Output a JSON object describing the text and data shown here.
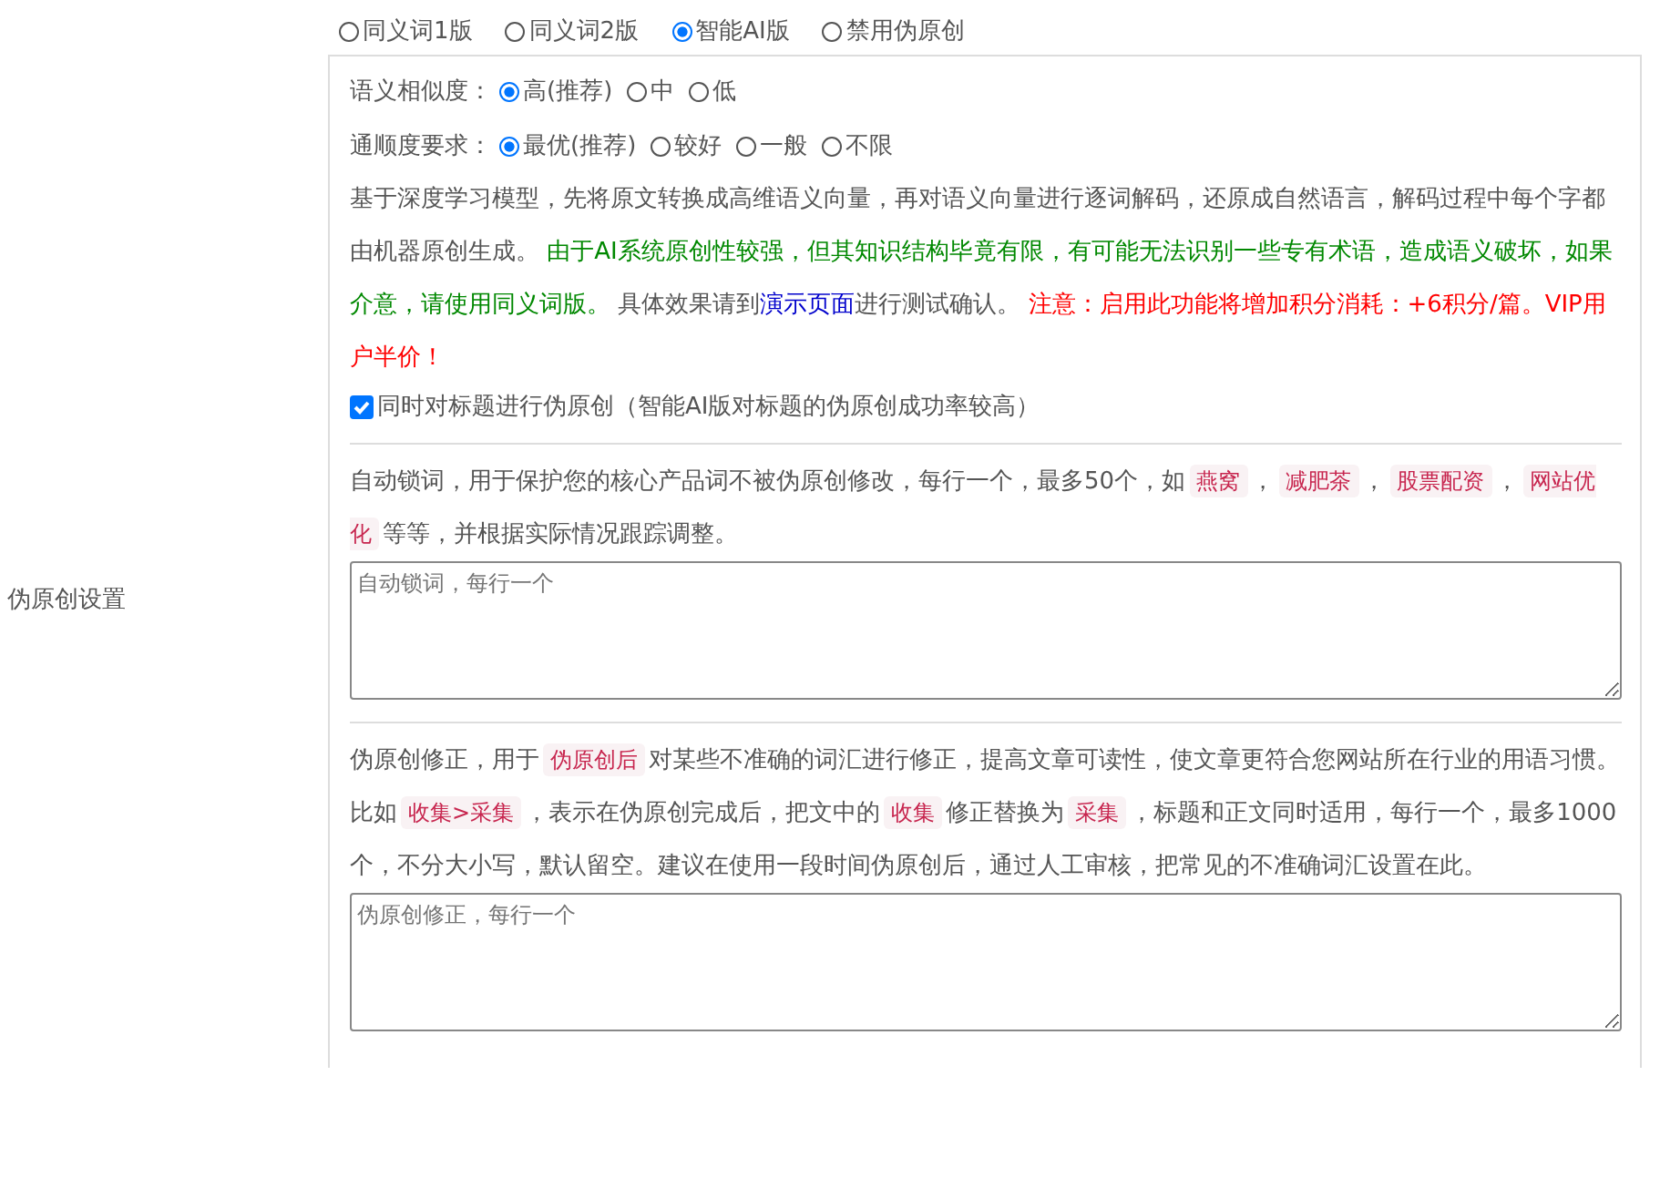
{
  "side_label": "伪原创设置",
  "modes": [
    {
      "label": "同义词1版",
      "selected": false
    },
    {
      "label": "同义词2版",
      "selected": false
    },
    {
      "label": "智能AI版",
      "selected": true
    },
    {
      "label": "禁用伪原创",
      "selected": false
    }
  ],
  "similarity": {
    "label": "语义相似度：",
    "options": [
      {
        "label": "高(推荐)",
        "selected": true
      },
      {
        "label": "中",
        "selected": false
      },
      {
        "label": "低",
        "selected": false
      }
    ]
  },
  "fluency": {
    "label": "通顺度要求：",
    "options": [
      {
        "label": "最优(推荐)",
        "selected": true
      },
      {
        "label": "较好",
        "selected": false
      },
      {
        "label": "一般",
        "selected": false
      },
      {
        "label": "不限",
        "selected": false
      }
    ]
  },
  "ai_description": [
    {
      "kind": "plain",
      "text": "基于深度学习模型，先将原文转换成高维语义向量，再对语义向量进行逐词解码，还原成自然语言，解码过程中每个字都由机器原创生成。 "
    },
    {
      "kind": "notice",
      "text": "由于AI系统原创性较强，但其知识结构毕竟有限，有可能无法识别一些专有术语，造成语义破坏，如果介意，请使用同义词版。"
    },
    {
      "kind": "plain",
      "text": " 具体效果请到"
    },
    {
      "kind": "link",
      "text": "演示页面"
    },
    {
      "kind": "plain",
      "text": "进行测试确认。 "
    },
    {
      "kind": "warning",
      "text": "注意：启用此功能将增加积分消耗：+6积分/篇。VIP用户半价！"
    }
  ],
  "title_option": {
    "label": "同时对标题进行伪原创（智能AI版对标题的伪原创成功率较高）",
    "checked": true
  },
  "lock_words": {
    "description": [
      {
        "kind": "plain",
        "text": "自动锁词，用于保护您的核心产品词不被伪原创修改，每行一个，最多50个，如"
      },
      {
        "kind": "code",
        "text": "燕窝"
      },
      {
        "kind": "plain",
        "text": "，"
      },
      {
        "kind": "code",
        "text": "减肥茶"
      },
      {
        "kind": "plain",
        "text": "，"
      },
      {
        "kind": "code",
        "text": "股票配资"
      },
      {
        "kind": "plain",
        "text": "，"
      },
      {
        "kind": "code",
        "text": "网站优化"
      },
      {
        "kind": "plain",
        "text": "等等，并根据实际情况跟踪调整。"
      }
    ],
    "placeholder": "自动锁词，每行一个"
  },
  "correction": {
    "description": [
      {
        "kind": "plain",
        "text": "伪原创修正，用于"
      },
      {
        "kind": "code",
        "text": "伪原创后"
      },
      {
        "kind": "plain",
        "text": "对某些不准确的词汇进行修正，提高文章可读性，使文章更符合您网站所在行业的用语习惯。比如"
      },
      {
        "kind": "code",
        "text": "收集>采集"
      },
      {
        "kind": "plain",
        "text": "，表示在伪原创完成后，把文中的"
      },
      {
        "kind": "code",
        "text": "收集"
      },
      {
        "kind": "plain",
        "text": "修正替换为"
      },
      {
        "kind": "code",
        "text": "采集"
      },
      {
        "kind": "plain",
        "text": "，标题和正文同时适用，每行一个，最多1000个，不分大小写，默认留空。建议在使用一段时间伪原创后，通过人工审核，把常见的不准确词汇设置在此。"
      }
    ],
    "placeholder": "伪原创修正，每行一个"
  }
}
